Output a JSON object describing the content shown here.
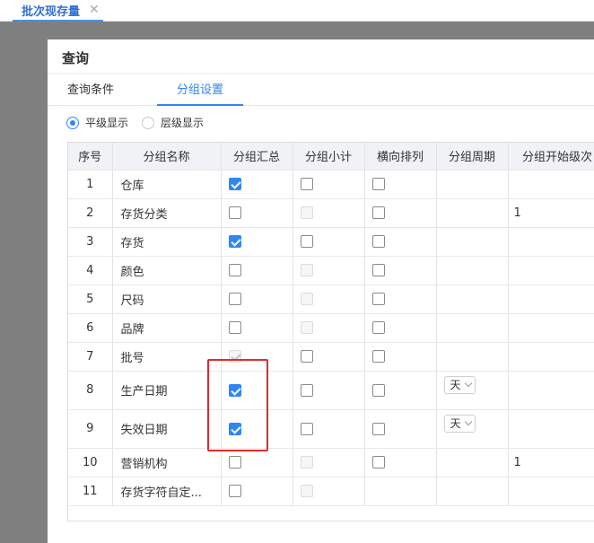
{
  "top_tab": {
    "label": "批次现存量",
    "close": "✕"
  },
  "dialog": {
    "title": "查询",
    "tabs": [
      {
        "label": "查询条件",
        "active": false
      },
      {
        "label": "分组设置",
        "active": true
      }
    ],
    "display_mode": {
      "options": [
        "平级显示",
        "层级显示"
      ],
      "selected": "平级显示"
    }
  },
  "table": {
    "columns": [
      "序号",
      "分组名称",
      "分组汇总",
      "分组小计",
      "横向排列",
      "分组周期",
      "分组开始级次"
    ],
    "rows": [
      {
        "no": "1",
        "name": "仓库",
        "summary": "checked",
        "subtotal": "unchecked",
        "horizontal": "unchecked",
        "period": "",
        "level": ""
      },
      {
        "no": "2",
        "name": "存货分类",
        "summary": "unchecked",
        "subtotal": "disabled",
        "horizontal": "unchecked",
        "period": "",
        "level": "1"
      },
      {
        "no": "3",
        "name": "存货",
        "summary": "checked",
        "subtotal": "unchecked",
        "horizontal": "unchecked",
        "period": "",
        "level": ""
      },
      {
        "no": "4",
        "name": "颜色",
        "summary": "unchecked",
        "subtotal": "disabled",
        "horizontal": "unchecked",
        "period": "",
        "level": ""
      },
      {
        "no": "5",
        "name": "尺码",
        "summary": "unchecked",
        "subtotal": "disabled",
        "horizontal": "unchecked",
        "period": "",
        "level": ""
      },
      {
        "no": "6",
        "name": "品牌",
        "summary": "unchecked",
        "subtotal": "disabled",
        "horizontal": "unchecked",
        "period": "",
        "level": ""
      },
      {
        "no": "7",
        "name": "批号",
        "summary": "disabled-checked",
        "subtotal": "unchecked",
        "horizontal": "unchecked",
        "period": "",
        "level": ""
      },
      {
        "no": "8",
        "name": "生产日期",
        "summary": "checked",
        "subtotal": "unchecked",
        "horizontal": "unchecked",
        "period": "天",
        "level": ""
      },
      {
        "no": "9",
        "name": "失效日期",
        "summary": "checked",
        "subtotal": "unchecked",
        "horizontal": "unchecked",
        "period": "天",
        "level": ""
      },
      {
        "no": "10",
        "name": "营销机构",
        "summary": "unchecked",
        "subtotal": "disabled",
        "horizontal": "unchecked",
        "period": "",
        "level": "1"
      },
      {
        "no": "11",
        "name": "存货字符自定...",
        "summary": "unchecked",
        "subtotal": "disabled",
        "horizontal": "",
        "period": "",
        "level": ""
      }
    ]
  },
  "colors": {
    "accent": "#2f86f6",
    "highlight": "#e02b2b",
    "header_bg": "#f0f2f5"
  }
}
